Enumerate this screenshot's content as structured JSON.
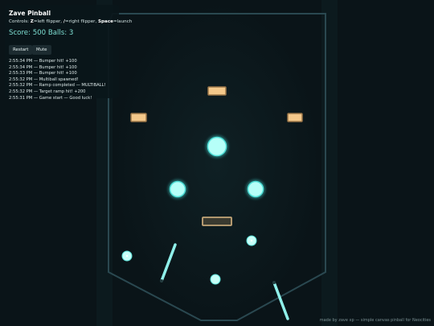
{
  "app": {
    "title": "Zave Pinball"
  },
  "controls": {
    "key_left": "Z",
    "left_label": "=left flipper, ",
    "key_right": "/",
    "right_label": "=right flipper, ",
    "key_launch": "Space",
    "launch_label": "=launch",
    "prefix": "Controls: "
  },
  "score": {
    "text": "Score: 500 Balls: 3",
    "value": 500,
    "balls": 3
  },
  "buttons": {
    "restart": "Restart",
    "mute": "Mute"
  },
  "log": [
    "2:55:34 PM — Bumper hit! +100",
    "2:55:34 PM — Bumper hit! +100",
    "2:55:33 PM — Bumper hit! +100",
    "2:55:32 PM — Multiball spawned!",
    "2:55:32 PM — Ramp completed — MULTIBALL!",
    "2:55:32 PM — Target ramp hit! +200",
    "2:55:31 PM — Game start — Good luck!"
  ],
  "footer": "made by zave xp — simple canvas pinball for Neocities",
  "colors": {
    "background": "#0a1418",
    "table_outline": "#2a4850",
    "bumper": "#b6fff8",
    "bumper_glow": "#3fd8d2",
    "target_fill": "#f4c88a",
    "target_border": "#9a7548",
    "flipper": "#8ff0ea",
    "score": "#7fe0d4"
  },
  "icons": {
    "ball": "ball-icon"
  }
}
